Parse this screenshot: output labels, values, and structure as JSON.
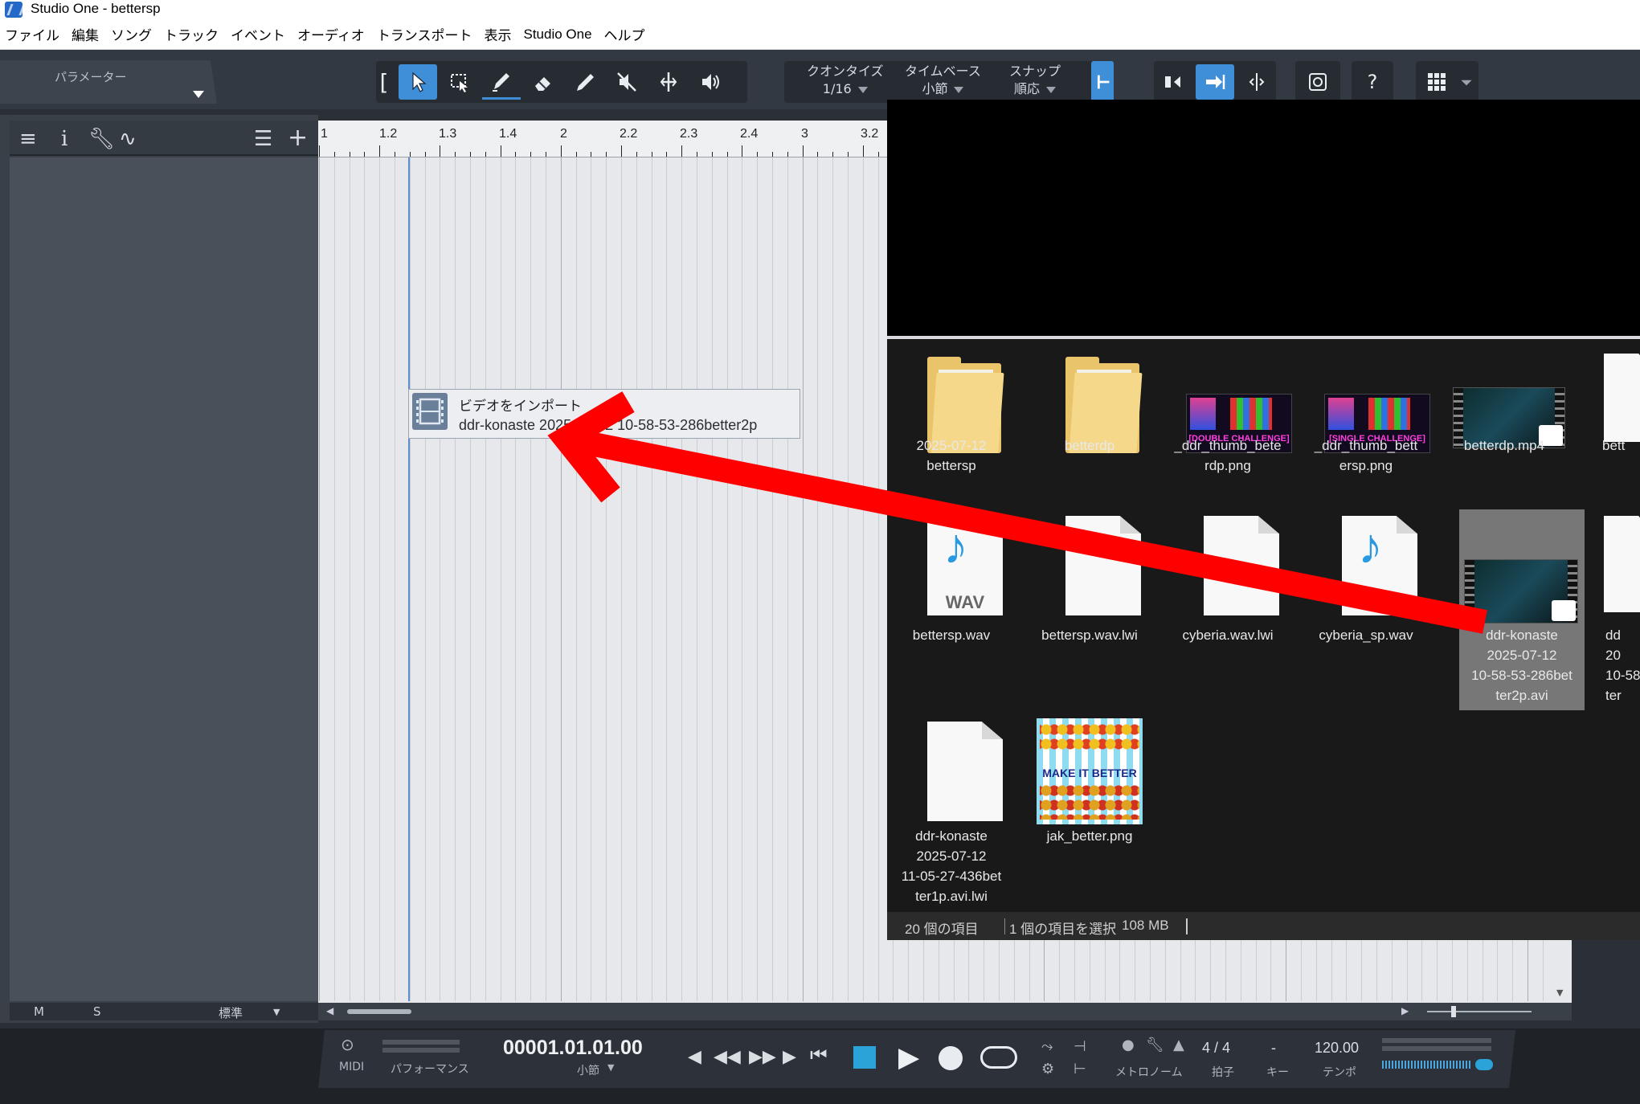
{
  "window": {
    "title": "Studio One - bettersp"
  },
  "menu": [
    "ファイル",
    "編集",
    "ソング",
    "トラック",
    "イベント",
    "オーディオ",
    "トランスポート",
    "表示",
    "Studio One",
    "ヘルプ"
  ],
  "toolbar": {
    "parameters_label": "パラメーター",
    "quantize_label": "クオンタイズ",
    "quantize_value": "1/16",
    "timebase_label": "タイムベース",
    "timebase_value": "小節",
    "snap_label": "スナップ",
    "snap_value": "順応",
    "help_label": "?"
  },
  "ruler": {
    "labels": [
      "1",
      "1.2",
      "1.3",
      "1.4",
      "2",
      "2.2",
      "2.3",
      "2.4",
      "3",
      "3.2"
    ]
  },
  "tracklist": {
    "m_label": "M",
    "s_label": "S",
    "mode_label": "標準"
  },
  "import_tooltip": {
    "title": "ビデオをインポート",
    "filename": "ddr-konaste 2025-07-12 10-58-53-286better2p"
  },
  "transport": {
    "midi_label": "MIDI",
    "performance_label": "パフォーマンス",
    "position": "00001.01.01.00",
    "position_unit": "小節",
    "metronome_label": "メトロノーム",
    "time_signature": "4 / 4",
    "time_signature_label": "拍子",
    "key_value": "-",
    "key_label": "キー",
    "tempo": "120.00",
    "tempo_label": "テンポ"
  },
  "explorer": {
    "items": [
      {
        "name": "2025-07-12\nbettersp",
        "type": "folder"
      },
      {
        "name": "betterdp",
        "type": "folder"
      },
      {
        "name": "_ddr_thumb_bete\nrdp.png",
        "type": "image",
        "badge": "[DOUBLE CHALLENGE]"
      },
      {
        "name": "_ddr_thumb_bett\nersp.png",
        "type": "image",
        "badge": "[SINGLE CHALLENGE]"
      },
      {
        "name": "betterdp.mp4",
        "type": "video"
      },
      {
        "name": "bett",
        "type": "partial"
      },
      {
        "name": "bettersp.wav",
        "type": "audio"
      },
      {
        "name": "bettersp.wav.lwi",
        "type": "file"
      },
      {
        "name": "cyberia.wav.lwi",
        "type": "file"
      },
      {
        "name": "cyberia_sp.wav",
        "type": "audio"
      },
      {
        "name": "ddr-konaste\n2025-07-12\n10-58-53-286bet\nter2p.avi",
        "type": "video",
        "selected": true
      },
      {
        "name": "dd\n20\n10-58\nter",
        "type": "partial"
      },
      {
        "name": "ddr-konaste\n2025-07-12\n11-05-27-436bet\nter1p.avi.lwi",
        "type": "file"
      },
      {
        "name": "jak_better.png",
        "type": "image",
        "badge": "MAKE IT BETTER"
      }
    ],
    "wav_label": "WAV",
    "status_count": "20 個の項目",
    "status_selected": "1 個の項目を選択",
    "status_size": "108 MB"
  },
  "colors": {
    "accent": "#3f8fd8",
    "arrow": "#ff0000",
    "selected_item": "#777777"
  }
}
